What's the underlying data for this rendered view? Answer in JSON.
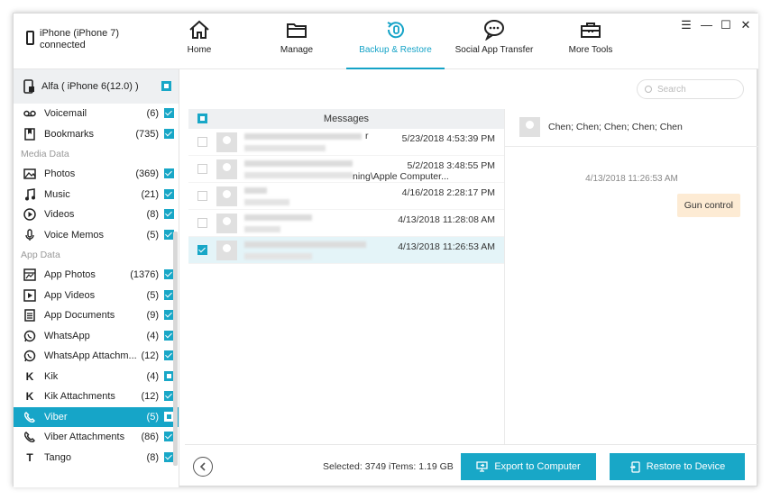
{
  "device": {
    "name": "iPhone (iPhone 7)",
    "status": "connected"
  },
  "nav": [
    {
      "label": "Home",
      "icon": "home-icon"
    },
    {
      "label": "Manage",
      "icon": "folder-icon"
    },
    {
      "label": "Backup & Restore",
      "icon": "backup-restore-icon",
      "active": true
    },
    {
      "label": "Social App Transfer",
      "icon": "chat-bubbles-icon"
    },
    {
      "label": "More Tools",
      "icon": "toolbox-icon"
    }
  ],
  "window_controls": {
    "menu": "☰",
    "minimize": "—",
    "maximize": "☐",
    "close": "✕"
  },
  "sidebar": {
    "backup_name": "Alfa ( iPhone 6(12.0) )",
    "sections": {
      "media": "Media Data",
      "app": "App Data"
    },
    "top_items": [
      {
        "label": "Voicemail",
        "count": "(6)",
        "icon": "voicemail-icon"
      },
      {
        "label": "Bookmarks",
        "count": "(735)",
        "icon": "bookmark-icon"
      }
    ],
    "media_items": [
      {
        "label": "Photos",
        "count": "(369)",
        "icon": "photo-icon"
      },
      {
        "label": "Music",
        "count": "(21)",
        "icon": "music-icon"
      },
      {
        "label": "Videos",
        "count": "(8)",
        "icon": "video-icon"
      },
      {
        "label": "Voice Memos",
        "count": "(5)",
        "icon": "microphone-icon"
      }
    ],
    "app_items": [
      {
        "label": "App Photos",
        "count": "(1376)",
        "icon": "app-photo-icon"
      },
      {
        "label": "App Videos",
        "count": "(5)",
        "icon": "app-video-icon"
      },
      {
        "label": "App Documents",
        "count": "(9)",
        "icon": "document-icon"
      },
      {
        "label": "WhatsApp",
        "count": "(4)",
        "icon": "whatsapp-icon"
      },
      {
        "label": "WhatsApp Attachm...",
        "count": "(12)",
        "icon": "whatsapp-attachment-icon"
      },
      {
        "label": "Kik",
        "count": "(4)",
        "icon": "kik-icon"
      },
      {
        "label": "Kik Attachments",
        "count": "(12)",
        "icon": "kik-attachment-icon"
      },
      {
        "label": "Viber",
        "count": "(5)",
        "icon": "viber-icon",
        "selected": true
      },
      {
        "label": "Viber Attachments",
        "count": "(86)",
        "icon": "viber-attachment-icon"
      },
      {
        "label": "Tango",
        "count": "(8)",
        "icon": "tango-icon"
      }
    ]
  },
  "search": {
    "placeholder": "Search"
  },
  "messages": {
    "header": "Messages",
    "rows": [
      {
        "date": "5/23/2018 4:53:39 PM",
        "preview_tail": "r",
        "preview": "",
        "checked": false
      },
      {
        "date": "5/2/2018 3:48:55 PM",
        "preview_tail": "",
        "preview": "ning\\Apple Computer...",
        "checked": false
      },
      {
        "date": "4/16/2018 2:28:17 PM",
        "preview_tail": "",
        "preview": "",
        "checked": false
      },
      {
        "date": "4/13/2018 11:28:08 AM",
        "preview_tail": "",
        "preview": "",
        "checked": false
      },
      {
        "date": "4/13/2018 11:26:53 AM",
        "preview_tail": "",
        "preview": "",
        "checked": true
      }
    ]
  },
  "detail": {
    "contact": "Chen; Chen; Chen; Chen; Chen",
    "timestamp": "4/13/2018 11:26:53 AM",
    "message": "Gun control"
  },
  "footer": {
    "selected": "Selected: 3749 iTems: 1.19 GB",
    "export_label": "Export to Computer",
    "restore_label": "Restore to Device"
  },
  "colors": {
    "accent": "#16a5c8",
    "bubble": "#fdebd4"
  }
}
